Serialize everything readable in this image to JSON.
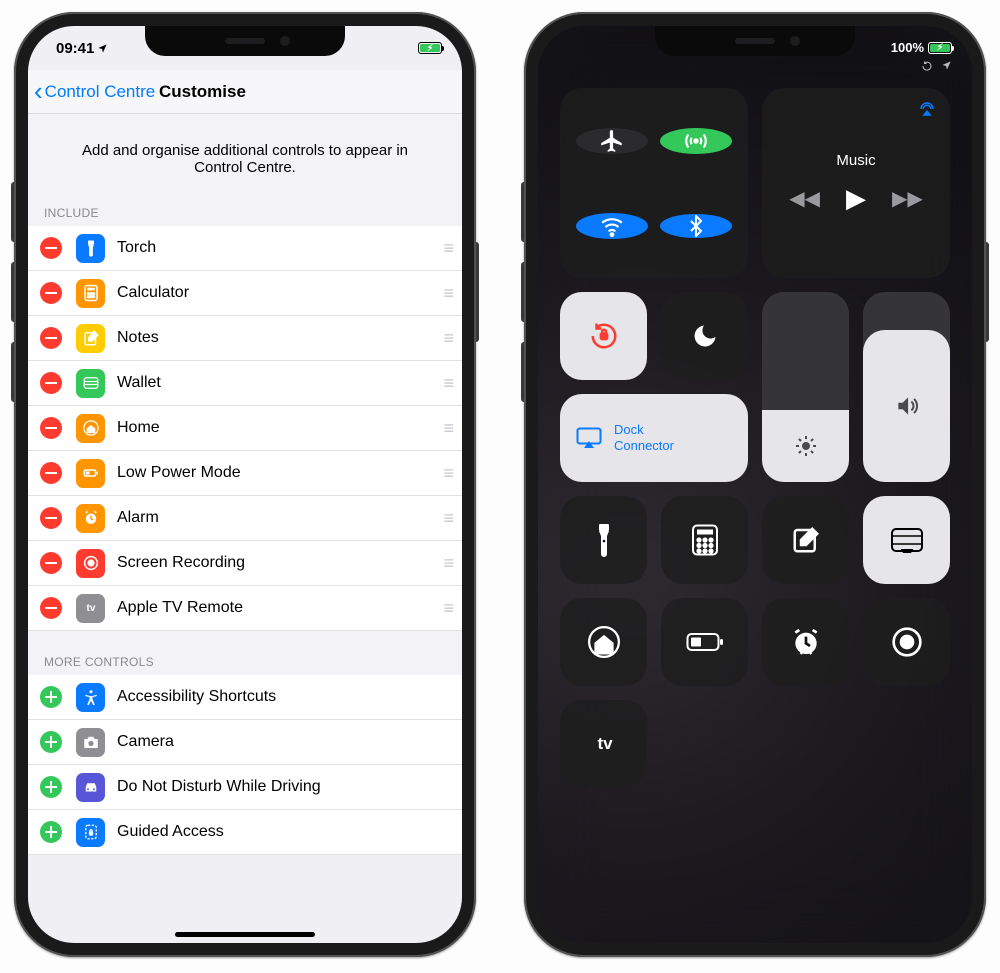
{
  "left": {
    "status": {
      "time": "09:41",
      "loc_icon": "location-icon"
    },
    "nav": {
      "back_label": "Control Centre",
      "title": "Customise"
    },
    "intro": "Add and organise additional controls to appear in Control Centre.",
    "section_include": "INCLUDE",
    "include": [
      {
        "name": "Torch",
        "icon_bg": "#0a7aff",
        "glyph": "torch"
      },
      {
        "name": "Calculator",
        "icon_bg": "#ff9500",
        "glyph": "calc"
      },
      {
        "name": "Notes",
        "icon_bg": "#ffcc00",
        "glyph": "notes"
      },
      {
        "name": "Wallet",
        "icon_bg": "#34c759",
        "glyph": "wallet"
      },
      {
        "name": "Home",
        "icon_bg": "#ff9500",
        "glyph": "home"
      },
      {
        "name": "Low Power Mode",
        "icon_bg": "#ff9500",
        "glyph": "battery"
      },
      {
        "name": "Alarm",
        "icon_bg": "#ff9500",
        "glyph": "alarm"
      },
      {
        "name": "Screen Recording",
        "icon_bg": "#ff3b30",
        "glyph": "record"
      },
      {
        "name": "Apple TV Remote",
        "icon_bg": "#8e8e93",
        "glyph": "atv"
      }
    ],
    "section_more": "MORE CONTROLS",
    "more": [
      {
        "name": "Accessibility Shortcuts",
        "icon_bg": "#0a7aff",
        "glyph": "access"
      },
      {
        "name": "Camera",
        "icon_bg": "#8e8e93",
        "glyph": "camera"
      },
      {
        "name": "Do Not Disturb While Driving",
        "icon_bg": "#5856d6",
        "glyph": "car"
      },
      {
        "name": "Guided Access",
        "icon_bg": "#0a7aff",
        "glyph": "guided"
      }
    ]
  },
  "right": {
    "status": {
      "battery_pct": "100%"
    },
    "music": {
      "label": "Music"
    },
    "mirror": {
      "line1": "Dock",
      "line2": "Connector"
    },
    "atv_label": "tv"
  }
}
